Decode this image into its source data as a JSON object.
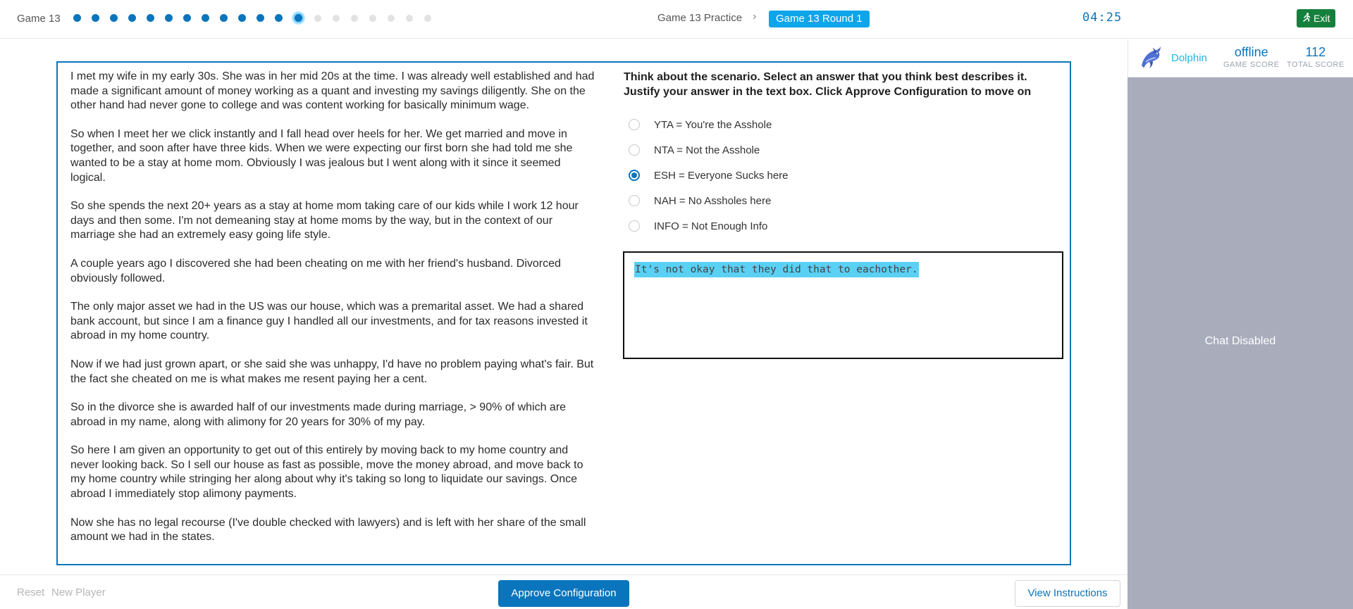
{
  "topbar": {
    "game_label": "Game 13",
    "progress": {
      "completed": 12,
      "current_index": 12,
      "total": 20
    },
    "breadcrumb_practice": "Game 13 Practice",
    "breadcrumb_separator": "›",
    "breadcrumb_round": "Game 13 Round 1",
    "timer": "04:25",
    "exit_label": "Exit",
    "exit_icon": "running-person-icon"
  },
  "story": {
    "paragraphs": [
      "I met my wife in my early 30s. She was in her mid 20s at the time. I was already well established and had made a significant amount of money working as a quant and investing my savings diligently. She on the other hand had never gone to college and was content working for basically minimum wage.",
      "So when I meet her we click instantly and I fall head over heels for her. We get married and move in together, and soon after have three kids. When we were expecting our first born she had told me she wanted to be a stay at home mom. Obviously I was jealous but I went along with it since it seemed logical.",
      "So she spends the next 20+ years as a stay at home mom taking care of our kids while I work 12 hour days and then some. I'm not demeaning stay at home moms by the way, but in the context of our marriage she had an extremely easy going life style.",
      "A couple years ago I discovered she had been cheating on me with her friend's husband. Divorced obviously followed.",
      "The only major asset we had in the US was our house, which was a premarital asset. We had a shared bank account, but since I am a finance guy I handled all our investments, and for tax reasons invested it abroad in my home country.",
      "Now if we had just grown apart, or she said she was unhappy, I'd have no problem paying what's fair. But the fact she cheated on me is what makes me resent paying her a cent.",
      "So in the divorce she is awarded half of our investments made during marriage, > 90% of which are abroad in my name, along with alimony for 20 years for 30% of my pay.",
      "So here I am given an opportunity to get out of this entirely by moving back to my home country and never looking back. So I sell our house as fast as possible, move the money abroad, and move back to my home country while stringing her along about why it's taking so long to liquidate our savings. Once abroad I immediately stop alimony payments.",
      "Now she has no legal recourse (I've double checked with lawyers) and is left with her share of the small amount we had in the states."
    ]
  },
  "question": {
    "prompt": "Think about the scenario. Select an answer that you think best describes it. Justify your answer in the text box. Click Approve Configuration to move on",
    "options": [
      {
        "label": "YTA = You're the Asshole",
        "selected": false
      },
      {
        "label": "NTA = Not the Asshole",
        "selected": false
      },
      {
        "label": "ESH = Everyone Sucks here",
        "selected": true
      },
      {
        "label": "NAH = No Assholes here",
        "selected": false
      },
      {
        "label": "INFO = Not Enough Info",
        "selected": false
      }
    ],
    "justification": "It's not okay that they did that to eachother."
  },
  "bottombar": {
    "reset_label": "Reset",
    "new_player_label": "New Player",
    "approve_label": "Approve Configuration",
    "instructions_label": "View Instructions"
  },
  "sidebar": {
    "avatar_icon": "dolphin-icon",
    "player_name": "Dolphin",
    "game_score_value": "offline",
    "game_score_label": "GAME SCORE",
    "total_score_value": "112",
    "total_score_label": "TOTAL SCORE",
    "chat_status": "Chat Disabled"
  },
  "colors": {
    "accent": "#0a75bc",
    "highlight": "#0ea5e9",
    "exit_green": "#15803d",
    "chat_bg": "#a9acbb"
  }
}
